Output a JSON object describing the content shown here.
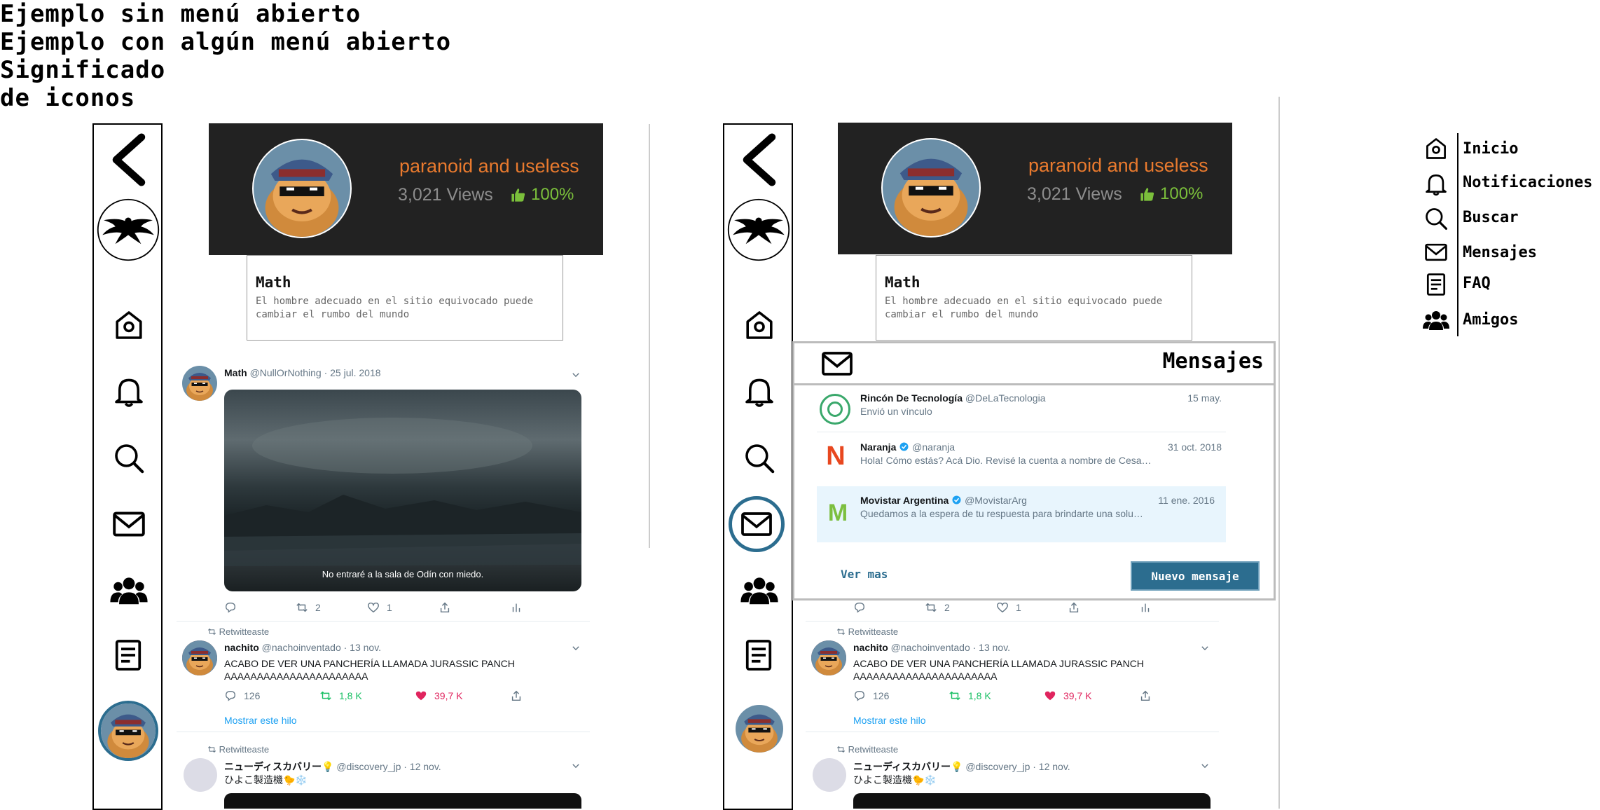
{
  "headings": {
    "closed": "Ejemplo sin menú abierto",
    "open": "Ejemplo con algún menú abierto",
    "legend_line1": "Significado",
    "legend_line2": "de iconos"
  },
  "sidebar_icons": [
    "back-arrow-icon",
    "logo-bird-icon",
    "home-icon",
    "bell-icon",
    "search-icon",
    "mail-icon",
    "friends-icon",
    "faq-icon",
    "avatar"
  ],
  "profile": {
    "name": "paranoid and useless",
    "views": "3,021 Views",
    "like_pct": "100%",
    "quote_title": "Math",
    "quote_text_line1": "El hombre adecuado en el sitio equivocado puede",
    "quote_text_line2": "cambiar el rumbo del mundo"
  },
  "tweet1": {
    "name": "Math",
    "handle_date": "@NullOrNothing · 25 jul. 2018",
    "caption": "No entraré a la sala de Odín con miedo.",
    "retweets": "2",
    "likes": "1"
  },
  "tweet2": {
    "retweeted_label": "Retwitteaste",
    "name": "nachito",
    "handle_date": "@nachoinventado · 13 nov.",
    "line1": "ACABO DE VER UNA PANCHERÍA LLAMADA JURASSIC PANCH",
    "line2": "AAAAAAAAAAAAAAAAAAAAAA",
    "replies": "126",
    "retweets": "1,8 K",
    "likes": "39,7 K",
    "thread_link": "Mostrar este hilo"
  },
  "tweet3": {
    "retweeted_label": "Retwitteaste",
    "name": "ニューディスカバリー💡",
    "handle_date": "@discovery_jp · 12 nov.",
    "line1": "ひよこ製造機🐤❄️"
  },
  "messages": {
    "title": "Mensajes",
    "items": [
      {
        "name": "Rincón De Tecnología",
        "handle": "@DeLaTecnologia",
        "date": "15 may.",
        "preview": "Envió un vínculo"
      },
      {
        "name": "Naranja",
        "handle": "@naranja",
        "date": "31 oct. 2018",
        "preview": "Hola! Cómo estás? Acá Dio. Revisé la cuenta a nombre de Cesa…"
      },
      {
        "name": "Movistar Argentina",
        "handle": "@MovistarArg",
        "date": "11 ene. 2016",
        "preview": "Quedamos a la espera de tu respuesta para brindarte una solu…"
      }
    ],
    "ver_mas": "Ver mas",
    "new_button": "Nuevo mensaje"
  },
  "legend": [
    {
      "icon": "home-icon",
      "label": "Inicio"
    },
    {
      "icon": "bell-icon",
      "label": "Notificaciones"
    },
    {
      "icon": "search-icon",
      "label": "Buscar"
    },
    {
      "icon": "mail-icon",
      "label": "Mensajes"
    },
    {
      "icon": "faq-icon",
      "label": "FAQ"
    },
    {
      "icon": "friends-icon",
      "label": "Amigos"
    }
  ],
  "colors": {
    "accent": "#2c6d8f",
    "banner": "#222222",
    "profile_name": "#e97a2e",
    "like_green": "#7bbf3b",
    "retweet_green": "#17bf63",
    "like_pink": "#e0245e",
    "link_blue": "#1da1f2",
    "message_highlight": "#e8f5fd"
  }
}
